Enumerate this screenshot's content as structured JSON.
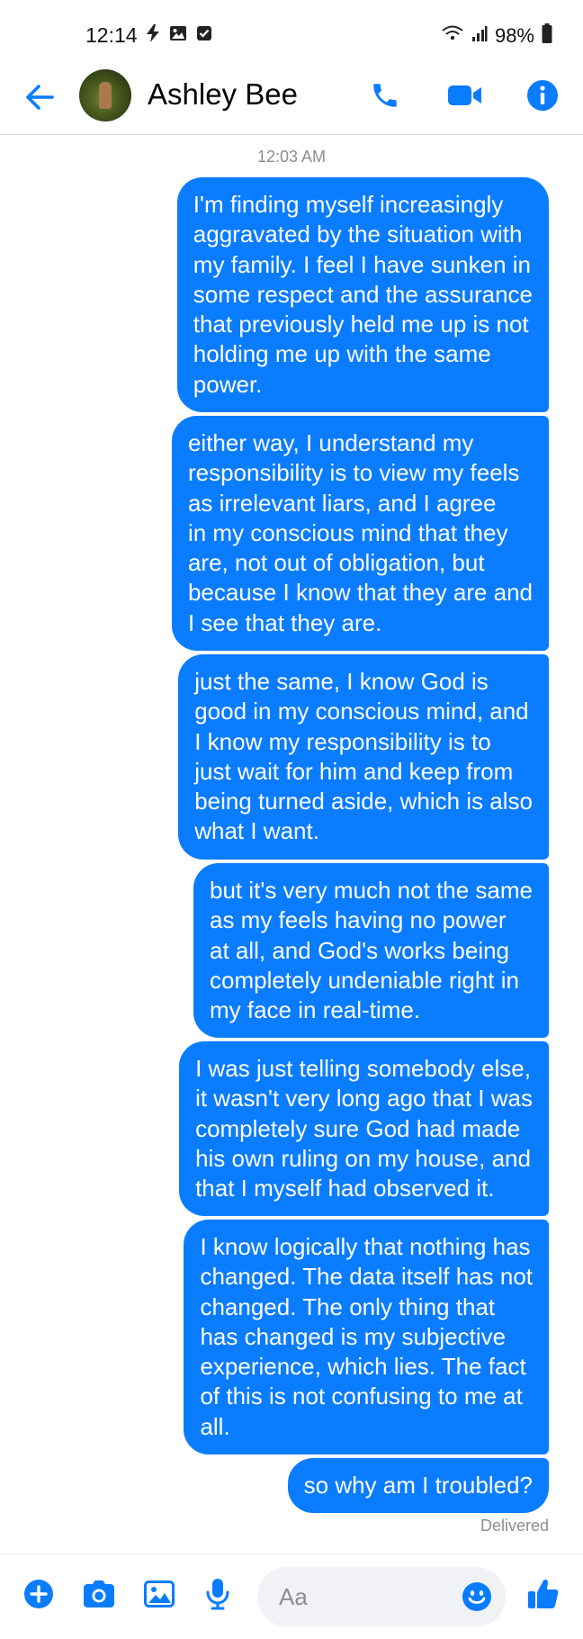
{
  "status_bar": {
    "time": "12:14",
    "battery": "98%",
    "left_icons": [
      "bolt-icon",
      "image-icon",
      "check-box-icon"
    ],
    "right_icons": [
      "wifi-icon",
      "signal-icon",
      "battery-icon"
    ]
  },
  "header": {
    "contact_name": "Ashley Bee",
    "accent_color": "#0a7cff"
  },
  "conversation": {
    "timestamp": "12:03 AM",
    "messages": [
      {
        "text": "I'm finding myself increasingly\naggravated by the situation with\nmy family. I feel I have sunken in\nsome respect and the assurance\nthat previously held me up is not\nholding me up with the same\npower."
      },
      {
        "text": "either way, I understand my\nresponsibility is to view my feels\nas irrelevant liars, and I agree\nin my conscious mind that they\nare, not out of obligation, but\nbecause I know that they are and\nI see that they are."
      },
      {
        "text": "just the same, I know God is\ngood in my conscious mind, and\nI know my responsibility is to\njust wait for him and keep from\nbeing turned aside, which is also\nwhat I want."
      },
      {
        "text": "but it's very much not the same\nas my feels having no power\nat all, and God's works being\ncompletely undeniable right in\nmy face in real-time."
      },
      {
        "text": "I was just telling somebody else,\nit wasn't very long ago that I was\ncompletely sure God had made\nhis own ruling on my house, and\nthat I myself had observed it."
      },
      {
        "text": "I know logically that nothing has\nchanged. The data itself has not\nchanged. The only thing that\nhas changed is my subjective\nexperience, which lies. The fact\nof this is not confusing to me at\nall."
      },
      {
        "text": "so why am I troubled?"
      }
    ],
    "status": "Delivered"
  },
  "composer": {
    "placeholder": "Aa"
  }
}
